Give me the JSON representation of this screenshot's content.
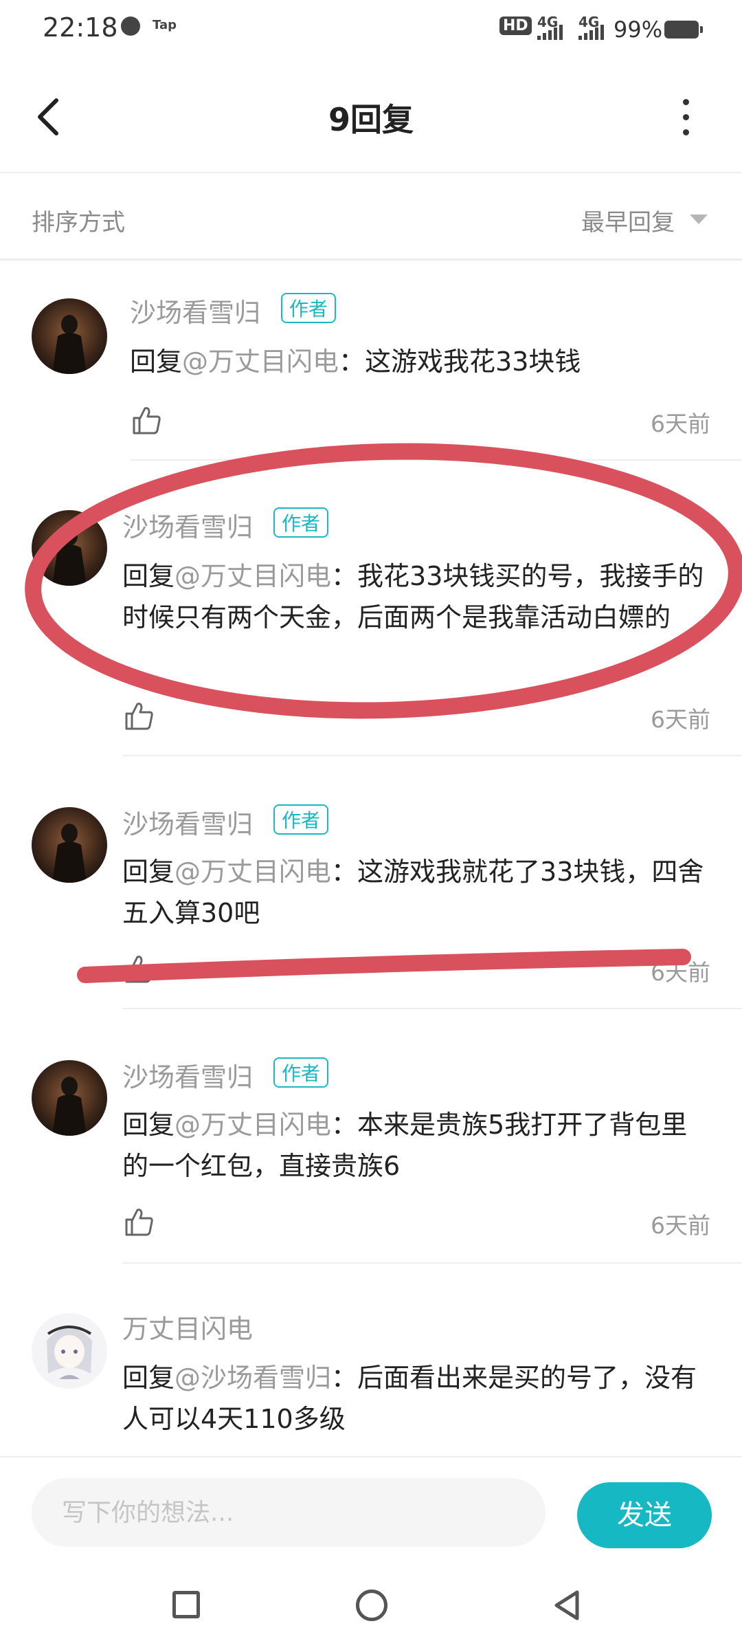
{
  "status_bar": {
    "time": "22:18",
    "tap_label": "Tap",
    "hd_label": "HD",
    "signal_1": "4G",
    "signal_2": "4G",
    "battery": "99%"
  },
  "header": {
    "title": "9回复"
  },
  "sort": {
    "label": "排序方式",
    "value": "最早回复"
  },
  "author_badge": "作者",
  "comments": [
    {
      "username": "沙场看雪归",
      "is_author": true,
      "reply_prefix": "回复",
      "mention": "@万丈目闪电",
      "text": "：这游戏我花33块钱",
      "time": "6天前"
    },
    {
      "username": "沙场看雪归",
      "is_author": true,
      "reply_prefix": "回复",
      "mention": "@万丈目闪电",
      "text": "：我花33块钱买的号，我接手的时候只有两个天金，后面两个是我靠活动白嫖的",
      "time": "6天前"
    },
    {
      "username": "沙场看雪归",
      "is_author": true,
      "reply_prefix": "回复",
      "mention": "@万丈目闪电",
      "text": "：这游戏我就花了33块钱，四舍五入算30吧",
      "time": "6天前"
    },
    {
      "username": "沙场看雪归",
      "is_author": true,
      "reply_prefix": "回复",
      "mention": "@万丈目闪电",
      "text": "：本来是贵族5我打开了背包里的一个红包，直接贵族6",
      "time": "6天前"
    },
    {
      "username": "万丈目闪电",
      "is_author": false,
      "reply_prefix": "回复",
      "mention": "@沙场看雪归",
      "text": "：后面看出来是买的号了，没有人可以4天110多级"
    }
  ],
  "composer": {
    "placeholder": "写下你的想法...",
    "send_label": "发送"
  },
  "annotation_color": "#d9515c",
  "accent_color": "#15b8c3"
}
